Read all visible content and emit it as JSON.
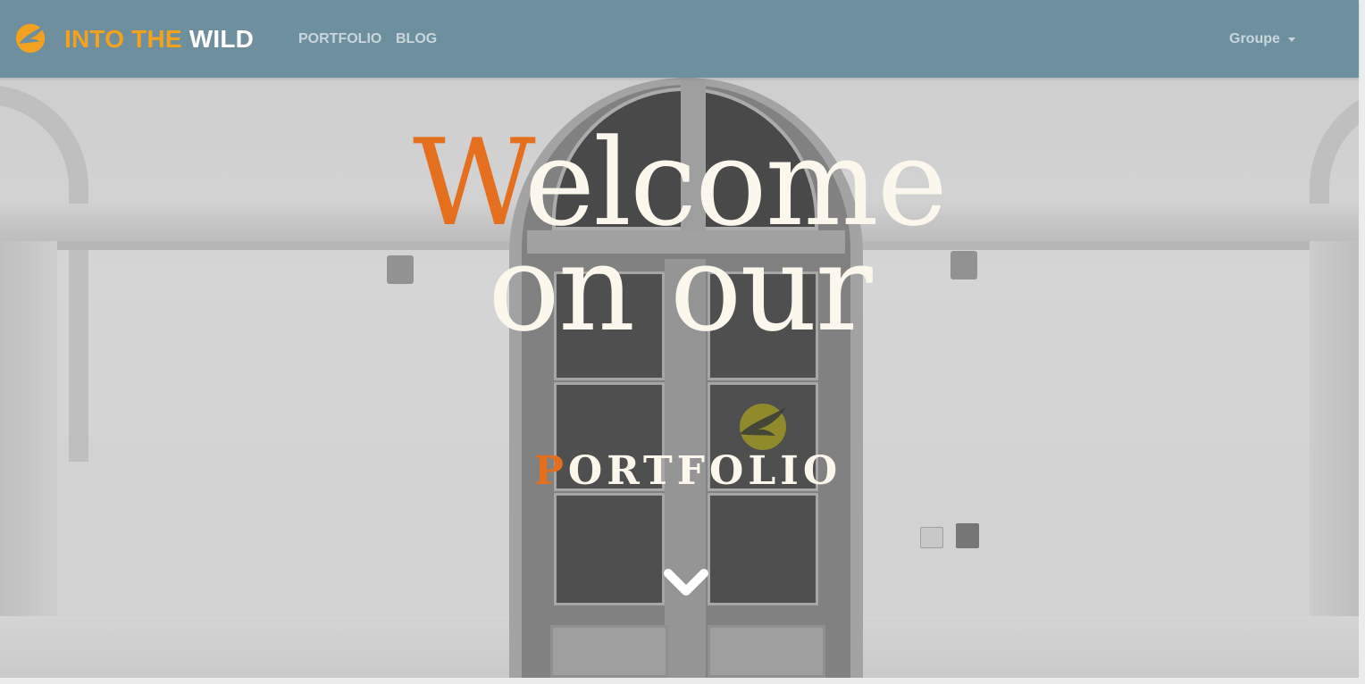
{
  "navbar": {
    "brand_part1": "INTO THE",
    "brand_part2": "WILD",
    "links": [
      {
        "label": "PORTFOLIO"
      },
      {
        "label": "BLOG"
      }
    ],
    "dropdown_label": "Groupe",
    "background_color": "#6e8f9d",
    "brand_accent_color": "#f2a21e"
  },
  "hero": {
    "line1_initial": "W",
    "line1_rest": "elcome",
    "line2": "on our",
    "subtitle_initial": "P",
    "subtitle_rest": "ORTFOLIO",
    "accent_color": "#e46f1f",
    "text_color": "#fbf7ec",
    "scroll_icon": "chevron-down-icon"
  }
}
